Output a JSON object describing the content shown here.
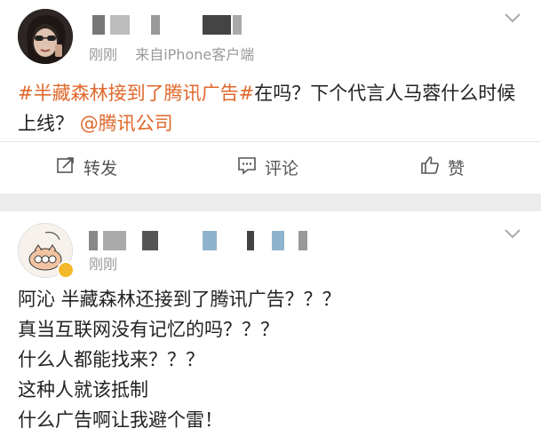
{
  "post1": {
    "timestamp": "刚刚",
    "source": "来自iPhone客户端",
    "topic": "#半藏森林接到了腾讯广告#",
    "text": "在吗？下个代言人马蓉什么时候上线？",
    "mention": "@腾讯公司",
    "actions": {
      "repost": "转发",
      "comment": "评论",
      "like": "赞"
    }
  },
  "post2": {
    "timestamp": "刚刚",
    "lines": [
      "阿沁  半藏森林还接到了腾讯广告？？？",
      "真当互联网没有记忆的吗？？？",
      "什么人都能找来？？？",
      "这种人就该抵制",
      "什么广告啊让我避个雷！"
    ]
  },
  "colors": {
    "link": "#e0672b",
    "badge": "#f3b92a",
    "background": "#ececec"
  },
  "icons": [
    "chevron-down-icon",
    "repost-icon",
    "comment-icon",
    "like-icon",
    "verified-badge"
  ]
}
